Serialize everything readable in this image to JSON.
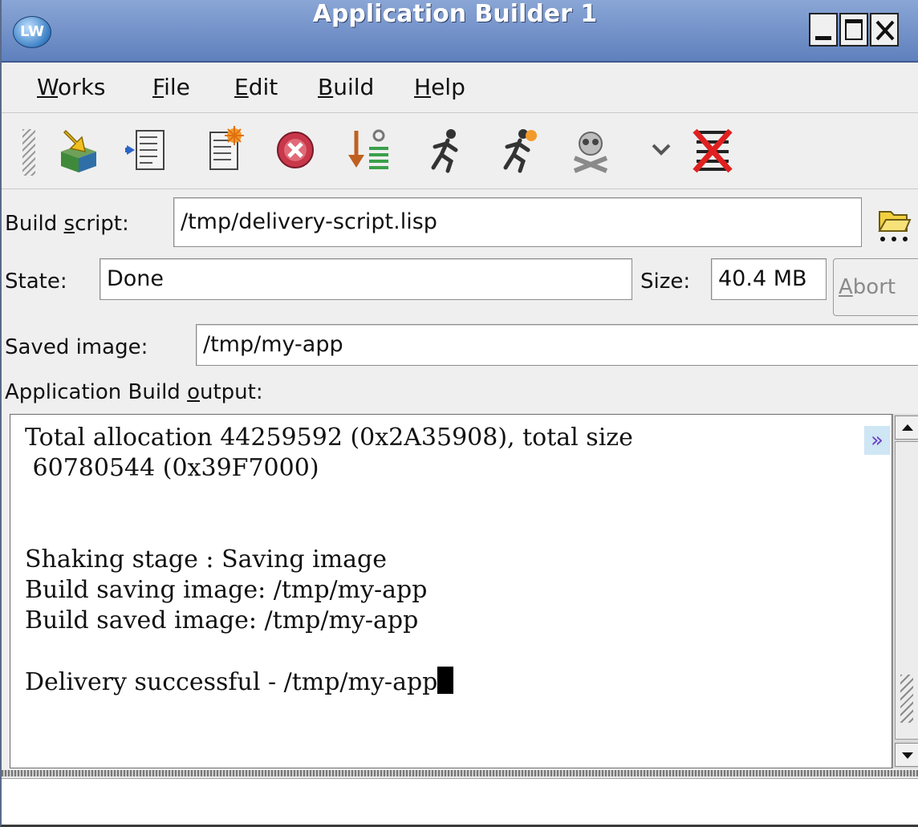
{
  "window": {
    "title": "Application Builder 1",
    "logo_text": "LW",
    "controls": [
      "minimize",
      "maximize",
      "close"
    ]
  },
  "menu": [
    {
      "label_acc": "W",
      "label_rest": "orks"
    },
    {
      "label_acc": "F",
      "label_rest": "ile"
    },
    {
      "label_acc": "E",
      "label_rest": "dit"
    },
    {
      "label_acc": "B",
      "label_rest": "uild"
    },
    {
      "label_acc": "H",
      "label_rest": "elp"
    }
  ],
  "toolbar": {
    "icons": [
      "build-box-icon",
      "parse-script-icon",
      "new-script-icon",
      "stop-icon",
      "step-down-icon",
      "run-icon",
      "run-delivery-icon",
      "kill-icon",
      "dropdown-chevron-icon",
      "clear-icon"
    ]
  },
  "form": {
    "build_script_label_pre": "Build ",
    "build_script_label_acc": "s",
    "build_script_label_post": "cript:",
    "build_script_value": "/tmp/delivery-script.lisp",
    "state_label": "State:",
    "state_value": "Done",
    "size_label": "Size:",
    "size_value": "40.4 MB",
    "abort_acc": "A",
    "abort_rest": "bort",
    "saved_image_label": "Saved image:",
    "saved_image_value": "/tmp/my-app",
    "output_label_pre": "Application Build ",
    "output_label_acc": "o",
    "output_label_post": "utput:"
  },
  "output": {
    "lines": [
      "Total allocation 44259592 (0x2A35908), total size",
      " 60780544 (0x39F7000)",
      "",
      "",
      "Shaking stage : Saving image",
      "Build saving image: /tmp/my-app",
      "Build saved image: /tmp/my-app",
      "",
      "Delivery successful - /tmp/my-app"
    ],
    "wrap_marker": "»"
  },
  "colors": {
    "titlebar": "#6f8fc9",
    "window_bg": "#efefef"
  }
}
